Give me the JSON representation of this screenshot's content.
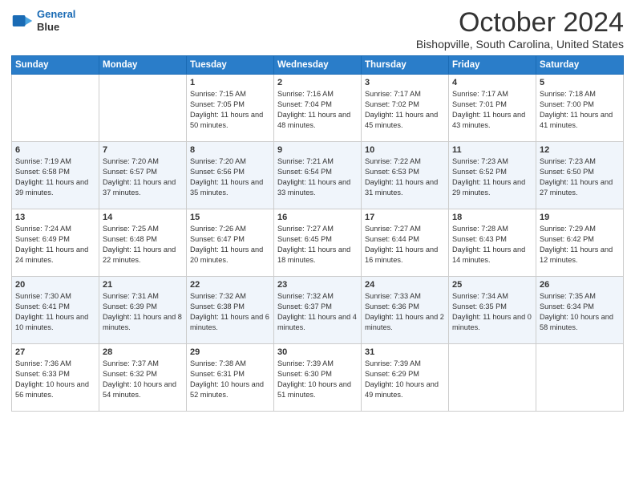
{
  "header": {
    "logo_line1": "General",
    "logo_line2": "Blue",
    "title": "October 2024",
    "subtitle": "Bishopville, South Carolina, United States"
  },
  "columns": [
    "Sunday",
    "Monday",
    "Tuesday",
    "Wednesday",
    "Thursday",
    "Friday",
    "Saturday"
  ],
  "weeks": [
    [
      {
        "day": "",
        "content": ""
      },
      {
        "day": "",
        "content": ""
      },
      {
        "day": "1",
        "content": "Sunrise: 7:15 AM\nSunset: 7:05 PM\nDaylight: 11 hours and 50 minutes."
      },
      {
        "day": "2",
        "content": "Sunrise: 7:16 AM\nSunset: 7:04 PM\nDaylight: 11 hours and 48 minutes."
      },
      {
        "day": "3",
        "content": "Sunrise: 7:17 AM\nSunset: 7:02 PM\nDaylight: 11 hours and 45 minutes."
      },
      {
        "day": "4",
        "content": "Sunrise: 7:17 AM\nSunset: 7:01 PM\nDaylight: 11 hours and 43 minutes."
      },
      {
        "day": "5",
        "content": "Sunrise: 7:18 AM\nSunset: 7:00 PM\nDaylight: 11 hours and 41 minutes."
      }
    ],
    [
      {
        "day": "6",
        "content": "Sunrise: 7:19 AM\nSunset: 6:58 PM\nDaylight: 11 hours and 39 minutes."
      },
      {
        "day": "7",
        "content": "Sunrise: 7:20 AM\nSunset: 6:57 PM\nDaylight: 11 hours and 37 minutes."
      },
      {
        "day": "8",
        "content": "Sunrise: 7:20 AM\nSunset: 6:56 PM\nDaylight: 11 hours and 35 minutes."
      },
      {
        "day": "9",
        "content": "Sunrise: 7:21 AM\nSunset: 6:54 PM\nDaylight: 11 hours and 33 minutes."
      },
      {
        "day": "10",
        "content": "Sunrise: 7:22 AM\nSunset: 6:53 PM\nDaylight: 11 hours and 31 minutes."
      },
      {
        "day": "11",
        "content": "Sunrise: 7:23 AM\nSunset: 6:52 PM\nDaylight: 11 hours and 29 minutes."
      },
      {
        "day": "12",
        "content": "Sunrise: 7:23 AM\nSunset: 6:50 PM\nDaylight: 11 hours and 27 minutes."
      }
    ],
    [
      {
        "day": "13",
        "content": "Sunrise: 7:24 AM\nSunset: 6:49 PM\nDaylight: 11 hours and 24 minutes."
      },
      {
        "day": "14",
        "content": "Sunrise: 7:25 AM\nSunset: 6:48 PM\nDaylight: 11 hours and 22 minutes."
      },
      {
        "day": "15",
        "content": "Sunrise: 7:26 AM\nSunset: 6:47 PM\nDaylight: 11 hours and 20 minutes."
      },
      {
        "day": "16",
        "content": "Sunrise: 7:27 AM\nSunset: 6:45 PM\nDaylight: 11 hours and 18 minutes."
      },
      {
        "day": "17",
        "content": "Sunrise: 7:27 AM\nSunset: 6:44 PM\nDaylight: 11 hours and 16 minutes."
      },
      {
        "day": "18",
        "content": "Sunrise: 7:28 AM\nSunset: 6:43 PM\nDaylight: 11 hours and 14 minutes."
      },
      {
        "day": "19",
        "content": "Sunrise: 7:29 AM\nSunset: 6:42 PM\nDaylight: 11 hours and 12 minutes."
      }
    ],
    [
      {
        "day": "20",
        "content": "Sunrise: 7:30 AM\nSunset: 6:41 PM\nDaylight: 11 hours and 10 minutes."
      },
      {
        "day": "21",
        "content": "Sunrise: 7:31 AM\nSunset: 6:39 PM\nDaylight: 11 hours and 8 minutes."
      },
      {
        "day": "22",
        "content": "Sunrise: 7:32 AM\nSunset: 6:38 PM\nDaylight: 11 hours and 6 minutes."
      },
      {
        "day": "23",
        "content": "Sunrise: 7:32 AM\nSunset: 6:37 PM\nDaylight: 11 hours and 4 minutes."
      },
      {
        "day": "24",
        "content": "Sunrise: 7:33 AM\nSunset: 6:36 PM\nDaylight: 11 hours and 2 minutes."
      },
      {
        "day": "25",
        "content": "Sunrise: 7:34 AM\nSunset: 6:35 PM\nDaylight: 11 hours and 0 minutes."
      },
      {
        "day": "26",
        "content": "Sunrise: 7:35 AM\nSunset: 6:34 PM\nDaylight: 10 hours and 58 minutes."
      }
    ],
    [
      {
        "day": "27",
        "content": "Sunrise: 7:36 AM\nSunset: 6:33 PM\nDaylight: 10 hours and 56 minutes."
      },
      {
        "day": "28",
        "content": "Sunrise: 7:37 AM\nSunset: 6:32 PM\nDaylight: 10 hours and 54 minutes."
      },
      {
        "day": "29",
        "content": "Sunrise: 7:38 AM\nSunset: 6:31 PM\nDaylight: 10 hours and 52 minutes."
      },
      {
        "day": "30",
        "content": "Sunrise: 7:39 AM\nSunset: 6:30 PM\nDaylight: 10 hours and 51 minutes."
      },
      {
        "day": "31",
        "content": "Sunrise: 7:39 AM\nSunset: 6:29 PM\nDaylight: 10 hours and 49 minutes."
      },
      {
        "day": "",
        "content": ""
      },
      {
        "day": "",
        "content": ""
      }
    ]
  ]
}
